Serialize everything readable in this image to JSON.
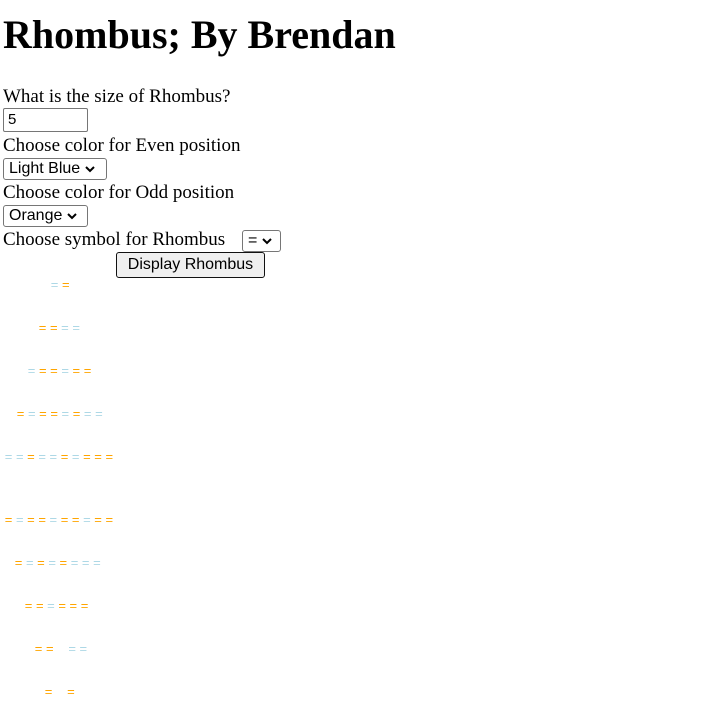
{
  "page": {
    "title": "Rhombus; By Brendan"
  },
  "form": {
    "size_label": "What is the size of Rhombus?",
    "size_value": "5",
    "even_label": "Choose color for Even position",
    "even_value": "Light Blue",
    "odd_label": "Choose color for Odd position",
    "odd_value": "Orange",
    "symbol_label": "Choose symbol for Rhombus",
    "symbol_value": "=",
    "display_button": "Display Rhombus"
  },
  "rhombus": {
    "symbol": "=",
    "colors": {
      "even": "#add8e6",
      "odd": "#ffa500"
    },
    "rows": [
      {
        "text": "==",
        "colors": [
          "even",
          "odd"
        ]
      },
      {
        "text": "====",
        "colors": [
          "odd",
          "odd",
          "even",
          "even"
        ]
      },
      {
        "text": "======",
        "colors": [
          "even",
          "odd",
          "odd",
          "even",
          "odd",
          "odd"
        ]
      },
      {
        "text": "========",
        "colors": [
          "odd",
          "even",
          "odd",
          "odd",
          "even",
          "odd",
          "even",
          "even"
        ]
      },
      {
        "text": "==========",
        "colors": [
          "even",
          "even",
          "odd",
          "even",
          "even",
          "odd",
          "even",
          "odd",
          "odd",
          "odd"
        ]
      },
      {
        "text": "==========",
        "colors": [
          "odd",
          "even",
          "odd",
          "odd",
          "even",
          "odd",
          "odd",
          "even",
          "odd",
          "odd"
        ]
      },
      {
        "text": "========",
        "colors": [
          "odd",
          "even",
          "odd",
          "even",
          "odd",
          "even",
          "even",
          "even"
        ]
      },
      {
        "text": "======",
        "colors": [
          "odd",
          "odd",
          "even",
          "odd",
          "odd",
          "odd"
        ]
      },
      {
        "text": "== ==",
        "colors": [
          "odd",
          "odd",
          "space",
          "even",
          "even"
        ]
      },
      {
        "text": "= =",
        "colors": [
          "odd",
          "space",
          "odd"
        ]
      }
    ]
  }
}
